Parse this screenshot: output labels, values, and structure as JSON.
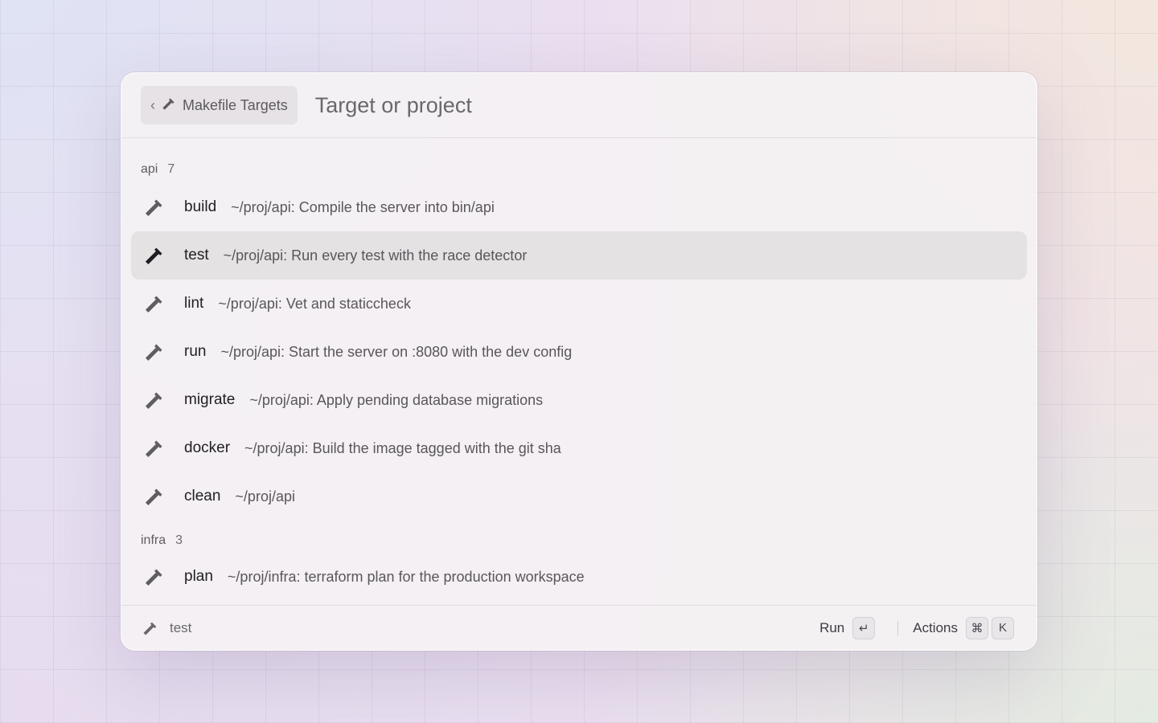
{
  "header": {
    "breadcrumb_label": "Makefile Targets",
    "search_placeholder": "Target or project"
  },
  "sections": [
    {
      "name": "api",
      "count": "7",
      "items": [
        {
          "name": "build",
          "desc": "~/proj/api: Compile the server into bin/api"
        },
        {
          "name": "test",
          "desc": "~/proj/api: Run every test with the race detector",
          "selected": true
        },
        {
          "name": "lint",
          "desc": "~/proj/api: Vet and staticcheck"
        },
        {
          "name": "run",
          "desc": "~/proj/api: Start the server on :8080 with the dev config"
        },
        {
          "name": "migrate",
          "desc": "~/proj/api: Apply pending database migrations"
        },
        {
          "name": "docker",
          "desc": "~/proj/api: Build the image tagged with the git sha"
        },
        {
          "name": "clean",
          "desc": "~/proj/api"
        }
      ]
    },
    {
      "name": "infra",
      "count": "3",
      "items": [
        {
          "name": "plan",
          "desc": "~/proj/infra: terraform plan for the production workspace"
        }
      ]
    }
  ],
  "footer": {
    "selected_label": "test",
    "run_label": "Run",
    "run_key": "↵",
    "actions_label": "Actions",
    "actions_keys": [
      "⌘",
      "K"
    ]
  },
  "icons": {
    "item_icon": "hammer-icon",
    "back_icon": "chevron-left-icon"
  }
}
